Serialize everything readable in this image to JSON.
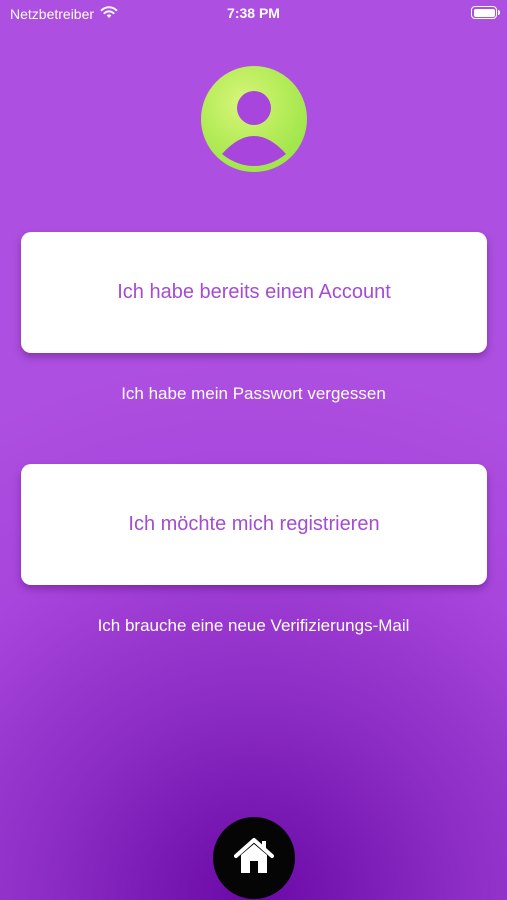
{
  "status_bar": {
    "carrier": "Netzbetreiber",
    "time": "7:38 PM"
  },
  "buttons": {
    "account_label": "Ich habe bereits einen Account",
    "register_label": "Ich möchte mich registrieren"
  },
  "links": {
    "forgot_password": "Ich habe mein Passwort vergessen",
    "verification_mail": "Ich brauche eine neue Verifizierungs-Mail"
  },
  "icons": {
    "avatar": "user-avatar-icon",
    "home": "home-icon",
    "wifi": "wifi-icon",
    "battery": "battery-icon"
  },
  "colors": {
    "background": "#a845dc",
    "button_text": "#a44cd2",
    "avatar": "#b5ec59",
    "home_button": "#050505"
  }
}
